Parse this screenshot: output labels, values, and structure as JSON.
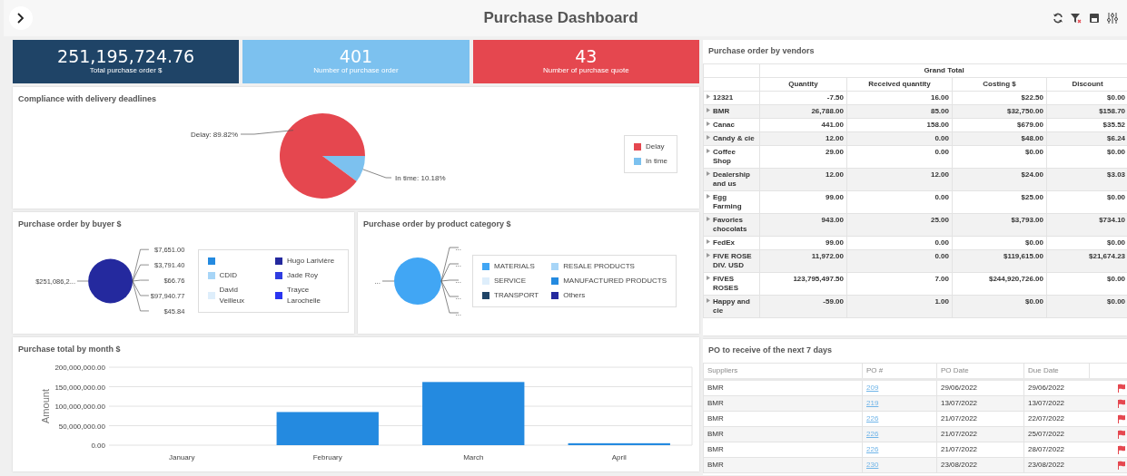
{
  "title": "Purchase Dashboard",
  "kpis": [
    {
      "value": "251,195,724.76",
      "label": "Total purchase order $",
      "color": "#1f4467"
    },
    {
      "value": "401",
      "label": "Number of purchase order",
      "color": "#7cc1ef"
    },
    {
      "value": "43",
      "label": "Number of purchase quote",
      "color": "#e5474f"
    }
  ],
  "compliance": {
    "title": "Compliance with delivery deadlines",
    "chart_data": {
      "type": "pie",
      "categories": [
        "Delay",
        "In time"
      ],
      "values": [
        89.82,
        10.18
      ],
      "colors": [
        "#e5474f",
        "#7cc1ef"
      ],
      "value_labels": [
        "Delay: 89.82%",
        "In time: 10.18%"
      ]
    }
  },
  "buyer": {
    "title": "Purchase order by buyer $",
    "left_label": "$251,086,2...",
    "labels": [
      "$7,651.00",
      "$3,791.40",
      "$66.76",
      "$97,940.77",
      "$45.84"
    ],
    "legend": [
      {
        "color": "#248ae0"
      },
      {
        "label": "Hugo Larivière",
        "color": "#24299e"
      },
      {
        "label": "CDID",
        "color": "#a7d5f7"
      },
      {
        "label": "Jade Roy",
        "color": "#2f3de0"
      },
      {
        "label": "David Veilleux",
        "color": "#deeefb"
      },
      {
        "label": "Trayce Larochelle",
        "color": "#2a35f0"
      }
    ]
  },
  "category": {
    "title": "Purchase order by product category $",
    "left_label": "...",
    "labels": [
      "...",
      "...",
      "...",
      "...",
      "..."
    ],
    "legend": [
      {
        "label": "MATERIALS",
        "color": "#41a6f4"
      },
      {
        "label": "RESALE PRODUCTS",
        "color": "#a7d5f7"
      },
      {
        "label": "SERVICE",
        "color": "#deeefb"
      },
      {
        "label": "MANUFACTURED PRODUCTS",
        "color": "#248ae0"
      },
      {
        "label": "TRANSPORT",
        "color": "#1f4467"
      },
      {
        "label": "Others",
        "color": "#24299e"
      }
    ]
  },
  "monthly": {
    "title": "Purchase total by month $",
    "chart_data": {
      "type": "bar",
      "ylabel": "Amount",
      "categories": [
        "January",
        "February",
        "March",
        "April"
      ],
      "grid": true,
      "series": [
        {
          "color": "#248ae0",
          "values": [
            0,
            85000000,
            162000000,
            5000000
          ]
        }
      ],
      "ylim": [
        0,
        200000000
      ],
      "yticks": [
        {
          "value": 0,
          "label": "0.00"
        },
        {
          "value": 50000000,
          "label": "50,000,000.00"
        },
        {
          "value": 100000000,
          "label": "100,000,000.00"
        },
        {
          "value": 150000000,
          "label": "150,000,000.00"
        },
        {
          "value": 200000000,
          "label": "200,000,000.00"
        }
      ]
    }
  },
  "vendors": {
    "title": "Purchase order by vendors",
    "group": "Grand Total",
    "columns": [
      "Quantity",
      "Received quantity",
      "Costing $",
      "Discount"
    ],
    "rows": [
      {
        "name": "12321",
        "cells": [
          "-7.50",
          "16.00",
          "$22.50",
          "$0.00"
        ]
      },
      {
        "name": "BMR",
        "cells": [
          "26,788.00",
          "85.00",
          "$32,750.00",
          "$158.70"
        ]
      },
      {
        "name": "Canac",
        "cells": [
          "441.00",
          "158.00",
          "$679.00",
          "$35.52"
        ]
      },
      {
        "name": "Candy & cie",
        "cells": [
          "12.00",
          "0.00",
          "$48.00",
          "$6.24"
        ]
      },
      {
        "name": "Coffee Shop",
        "cells": [
          "29.00",
          "0.00",
          "$0.00",
          "$0.00"
        ]
      },
      {
        "name": "Dealership and us",
        "cells": [
          "12.00",
          "12.00",
          "$24.00",
          "$3.03"
        ]
      },
      {
        "name": "Egg Farming",
        "cells": [
          "99.00",
          "0.00",
          "$25.00",
          "$0.00"
        ]
      },
      {
        "name": "Favories chocolats",
        "cells": [
          "943.00",
          "25.00",
          "$3,793.00",
          "$734.10"
        ]
      },
      {
        "name": "FedEx",
        "cells": [
          "99.00",
          "0.00",
          "$0.00",
          "$0.00"
        ]
      },
      {
        "name": "FIVE ROSE DIV. USD",
        "cells": [
          "11,972.00",
          "0.00",
          "$119,615.00",
          "$21,674.23"
        ]
      },
      {
        "name": "FIVES ROSES",
        "cells": [
          "123,795,497.50",
          "7.00",
          "$244,920,726.00",
          "$0.00"
        ]
      },
      {
        "name": "Happy and cie",
        "cells": [
          "-59.00",
          "1.00",
          "$0.00",
          "$0.00"
        ]
      }
    ]
  },
  "po": {
    "title": "PO to receive of the next 7 days",
    "columns": [
      "Suppliers",
      "PO #",
      "PO Date",
      "Due Date"
    ],
    "rows": [
      {
        "supplier": "BMR",
        "po": "209",
        "po_date": "29/06/2022",
        "due_date": "29/06/2022"
      },
      {
        "supplier": "BMR",
        "po": "219",
        "po_date": "13/07/2022",
        "due_date": "13/07/2022"
      },
      {
        "supplier": "BMR",
        "po": "226",
        "po_date": "21/07/2022",
        "due_date": "22/07/2022"
      },
      {
        "supplier": "BMR",
        "po": "226",
        "po_date": "21/07/2022",
        "due_date": "25/07/2022"
      },
      {
        "supplier": "BMR",
        "po": "226",
        "po_date": "21/07/2022",
        "due_date": "28/07/2022"
      },
      {
        "supplier": "BMR",
        "po": "230",
        "po_date": "23/08/2022",
        "due_date": "23/08/2022"
      }
    ]
  }
}
